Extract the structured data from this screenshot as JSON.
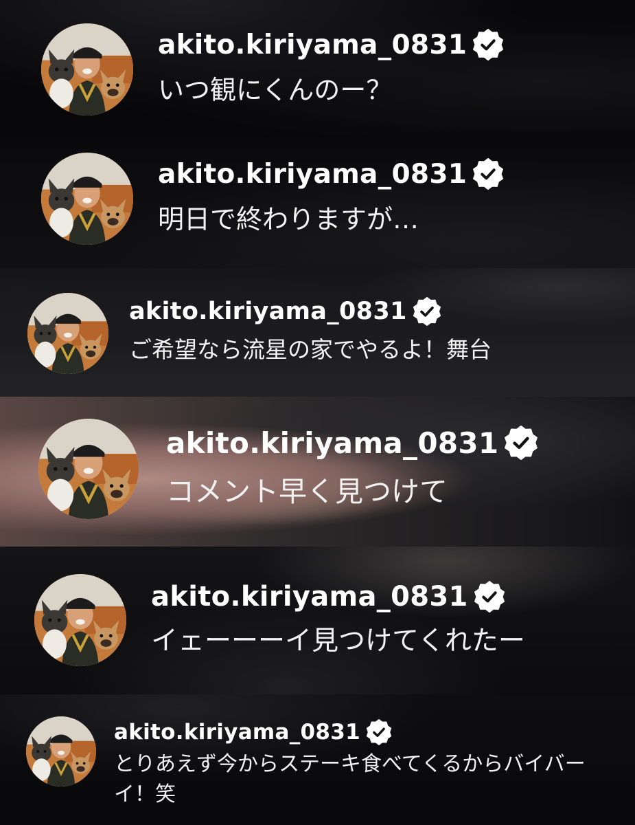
{
  "comments": [
    {
      "username": "akito.kiriyama_0831",
      "verified_icon": "verified-badge-icon",
      "text": "いつ観にくんのー？"
    },
    {
      "username": "akito.kiriyama_0831",
      "verified_icon": "verified-badge-icon",
      "text": "明日で終わりますが…"
    },
    {
      "username": "akito.kiriyama_0831",
      "verified_icon": "verified-badge-icon",
      "text": "ご希望なら流星の家でやるよ！舞台"
    },
    {
      "username": "akito.kiriyama_0831",
      "verified_icon": "verified-badge-icon",
      "text": "コメント早く見つけて"
    },
    {
      "username": "akito.kiriyama_0831",
      "verified_icon": "verified-badge-icon",
      "text": "イェーーーイ見つけてくれたー"
    },
    {
      "username": "akito.kiriyama_0831",
      "verified_icon": "verified-badge-icon",
      "text": "とりあえず今からステーキ食べてくるからバイバーイ！笑"
    }
  ],
  "colors": {
    "username": "#ffffff",
    "comment_text": "#f2f2f2",
    "badge_fill": "#ffffff",
    "badge_check": "#111111"
  }
}
